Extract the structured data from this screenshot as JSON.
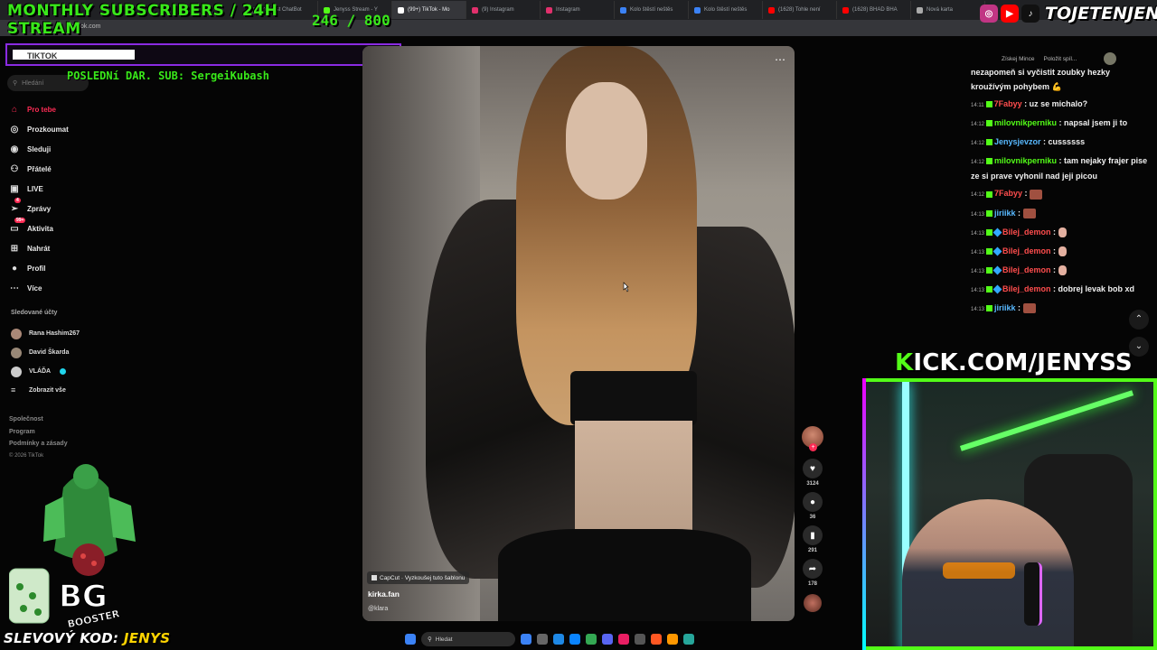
{
  "browser": {
    "tabs": [
      {
        "label": "The best ChatBot",
        "color": "#444"
      },
      {
        "label": "Jenyss Stream - Y",
        "color": "#53fc18"
      },
      {
        "label": "(99+) TikTok - Mo",
        "color": "#fff"
      },
      {
        "label": "(9) Instagram",
        "color": "#e1306c"
      },
      {
        "label": "Instagram",
        "color": "#e1306c"
      },
      {
        "label": "Kolo štěstí neštěs",
        "color": "#3b82f6"
      },
      {
        "label": "Kolo štěstí neštěs",
        "color": "#3b82f6"
      },
      {
        "label": "(1628) Tohle není",
        "color": "#ff0000"
      },
      {
        "label": "(1628) BHAD BHA",
        "color": "#ff0000"
      },
      {
        "label": "Nová karta",
        "color": "#aaa"
      }
    ],
    "url": "tiktok.com"
  },
  "overlay": {
    "title": "MONTHLY SUBSCRIBERS / 24H STREAM",
    "count": "246  / 800",
    "tiktok_label": "TIKTOK",
    "last_sub": "POSLEDNí DAR. SUB: SergeiKubash",
    "discount_label": "SLEVOVÝ KOD:",
    "discount_code": "JENYS",
    "kick_k": "K",
    "kick_rest": "ICK.COM/JENYSS",
    "channel_name": "TOJETENJENYS"
  },
  "sidebar": {
    "search_placeholder": "Hledání",
    "nav": [
      {
        "label": "Pro tebe",
        "icon": "home-icon",
        "glyph": "⌂",
        "active": true
      },
      {
        "label": "Prozkoumat",
        "icon": "compass-icon",
        "glyph": "◎"
      },
      {
        "label": "Sleduji",
        "icon": "following-icon",
        "glyph": "◉"
      },
      {
        "label": "Přátelé",
        "icon": "friends-icon",
        "glyph": "⚇"
      },
      {
        "label": "LIVE",
        "icon": "live-icon",
        "glyph": "▣"
      },
      {
        "label": "Zprávy",
        "icon": "messages-icon",
        "glyph": "➢",
        "badge": "4"
      },
      {
        "label": "Aktivita",
        "icon": "activity-icon",
        "glyph": "▭",
        "badge": "99+"
      },
      {
        "label": "Nahrát",
        "icon": "upload-icon",
        "glyph": "⊞"
      },
      {
        "label": "Profil",
        "icon": "profile-icon",
        "glyph": "●"
      },
      {
        "label": "Více",
        "icon": "more-icon",
        "glyph": "⋯"
      }
    ],
    "followed_title": "Sledované účty",
    "followed": [
      {
        "name": "Rana Hashim267"
      },
      {
        "name": "David Škarda"
      },
      {
        "name": "VLÁĎA",
        "verified": true
      },
      {
        "name": "Zobrazit vše"
      }
    ],
    "footer": [
      "Společnost",
      "Program",
      "Podmínky a zásady"
    ],
    "copyright": "© 2026 TikTok",
    "mascot_text": "BOOSTER"
  },
  "video": {
    "capcut": "CapCut · Vyzkoušej tuto šablonu",
    "username": "kirka.fan",
    "handle": "@klara",
    "likes": "3124",
    "comments": "36",
    "saves": "291",
    "shares": "178"
  },
  "chat": {
    "header": [
      "Získej Mince",
      "Položit spíl..."
    ],
    "messages": [
      {
        "time": "",
        "user": "",
        "text": "nezapomeň si vyčistit zoubky hezky kroužívým pohybem 💪",
        "color": "#f0f0f0"
      },
      {
        "time": "14:11",
        "user": "7Fabyy",
        "text": "uz se michalo?",
        "color": "#ff4d4d"
      },
      {
        "time": "14:12",
        "user": "milovnikperniku",
        "text": "napsal jsem ji to",
        "color": "#53fc18"
      },
      {
        "time": "14:12",
        "user": "Jenysjevzor",
        "text": "cussssss",
        "color": "#58b9ff"
      },
      {
        "time": "14:12",
        "user": "milovnikperniku",
        "text": "tam nejaky frajer pise ze si prave vyhonil nad jeji picou",
        "color": "#53fc18"
      },
      {
        "time": "14:12",
        "user": "7Fabyy",
        "text": "",
        "color": "#ff4d4d",
        "emote": true
      },
      {
        "time": "14:13",
        "user": "jiriikk",
        "text": "",
        "color": "#58b9ff",
        "emote": true
      },
      {
        "time": "14:13",
        "user": "Bilej_demon",
        "text": "",
        "color": "#ff4d4d",
        "emote2": true
      },
      {
        "time": "14:13",
        "user": "Bilej_demon",
        "text": "",
        "color": "#ff4d4d",
        "emote2": true
      },
      {
        "time": "14:13",
        "user": "Bilej_demon",
        "text": "",
        "color": "#ff4d4d",
        "emote2": true
      },
      {
        "time": "14:13",
        "user": "Bilej_demon",
        "text": "dobrej levak bob xd",
        "color": "#ff4d4d"
      },
      {
        "time": "14:13",
        "user": "jiriikk",
        "text": "",
        "color": "#58b9ff",
        "emote": true
      }
    ]
  },
  "taskbar": {
    "search": "Hledat",
    "icons": [
      "#3b82f6",
      "#666",
      "#1e88e5",
      "#0a84ff",
      "#34a853",
      "#5865f2",
      "#e91e63",
      "#555",
      "#ff5722",
      "#ff9800",
      "#26a69a"
    ]
  }
}
